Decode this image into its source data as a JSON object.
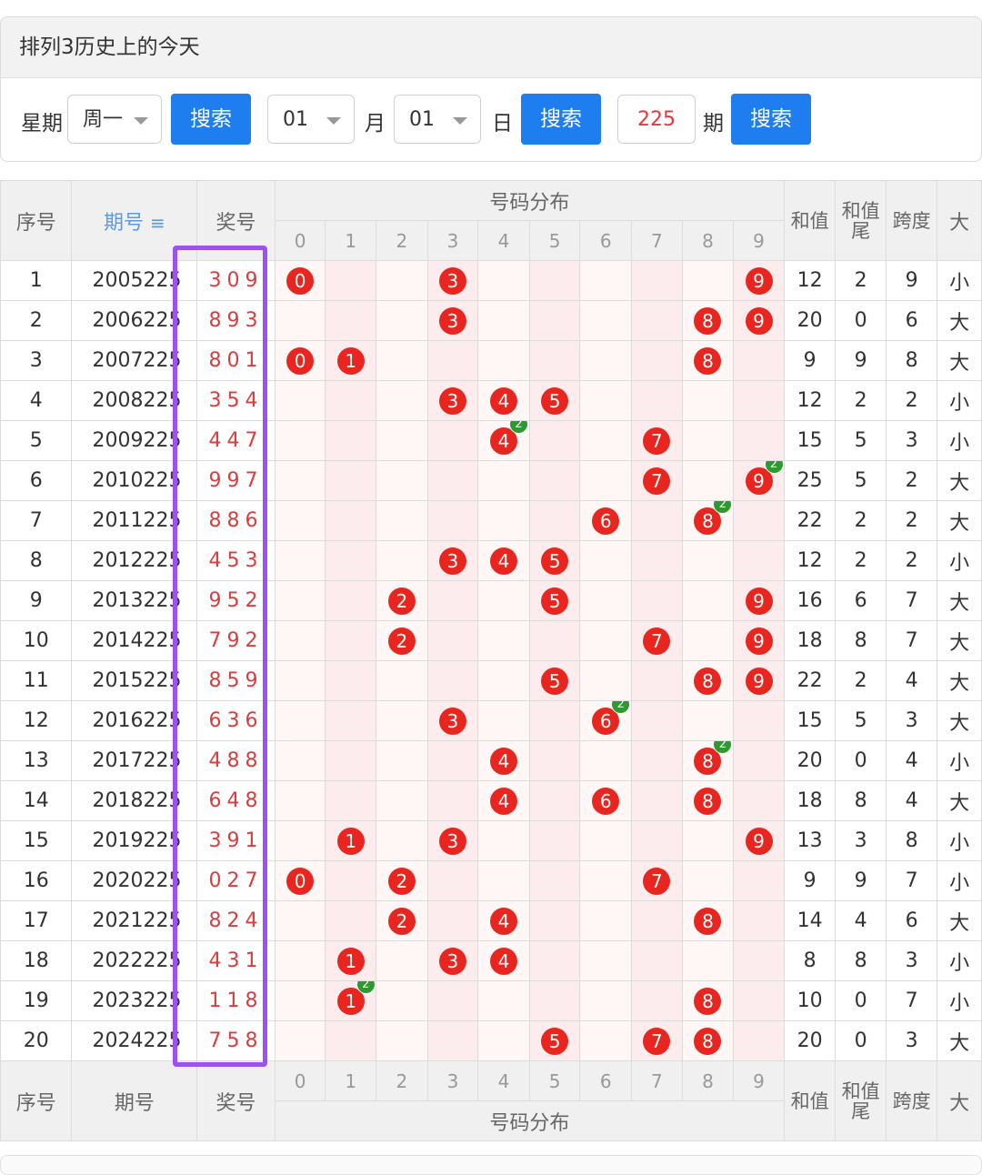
{
  "panel": {
    "title": "排列3历史上的今天",
    "weekday_label": "星期",
    "weekday_value": "周一",
    "search_label": "搜索",
    "month_value": "01",
    "month_label": "月",
    "day_value": "01",
    "day_label": "日",
    "period_value": "225",
    "period_label": "期"
  },
  "table": {
    "headers": {
      "seq": "序号",
      "period": "期号",
      "period_sort_icon": "sort-icon",
      "number": "奖号",
      "distribution": "号码分布",
      "digits": [
        "0",
        "1",
        "2",
        "3",
        "4",
        "5",
        "6",
        "7",
        "8",
        "9"
      ],
      "sum": "和值",
      "sum_tail": "和值尾",
      "span": "跨度",
      "size": "大"
    },
    "rows": [
      {
        "seq": "1",
        "period": "2005225",
        "num": "309",
        "digits": [
          0,
          3,
          9
        ],
        "rep": {},
        "sum": "12",
        "tail": "2",
        "span": "9",
        "size": "小"
      },
      {
        "seq": "2",
        "period": "2006225",
        "num": "893",
        "digits": [
          3,
          8,
          9
        ],
        "rep": {},
        "sum": "20",
        "tail": "0",
        "span": "6",
        "size": "大"
      },
      {
        "seq": "3",
        "period": "2007225",
        "num": "801",
        "digits": [
          0,
          1,
          8
        ],
        "rep": {},
        "sum": "9",
        "tail": "9",
        "span": "8",
        "size": "大"
      },
      {
        "seq": "4",
        "period": "2008225",
        "num": "354",
        "digits": [
          3,
          4,
          5
        ],
        "rep": {},
        "sum": "12",
        "tail": "2",
        "span": "2",
        "size": "小"
      },
      {
        "seq": "5",
        "period": "2009225",
        "num": "447",
        "digits": [
          4,
          7
        ],
        "rep": {
          "4": "2"
        },
        "sum": "15",
        "tail": "5",
        "span": "3",
        "size": "小"
      },
      {
        "seq": "6",
        "period": "2010225",
        "num": "997",
        "digits": [
          7,
          9
        ],
        "rep": {
          "9": "2"
        },
        "sum": "25",
        "tail": "5",
        "span": "2",
        "size": "大"
      },
      {
        "seq": "7",
        "period": "2011225",
        "num": "886",
        "digits": [
          6,
          8
        ],
        "rep": {
          "8": "2"
        },
        "sum": "22",
        "tail": "2",
        "span": "2",
        "size": "大"
      },
      {
        "seq": "8",
        "period": "2012225",
        "num": "453",
        "digits": [
          3,
          4,
          5
        ],
        "rep": {},
        "sum": "12",
        "tail": "2",
        "span": "2",
        "size": "小"
      },
      {
        "seq": "9",
        "period": "2013225",
        "num": "952",
        "digits": [
          2,
          5,
          9
        ],
        "rep": {},
        "sum": "16",
        "tail": "6",
        "span": "7",
        "size": "大"
      },
      {
        "seq": "10",
        "period": "2014225",
        "num": "792",
        "digits": [
          2,
          7,
          9
        ],
        "rep": {},
        "sum": "18",
        "tail": "8",
        "span": "7",
        "size": "大"
      },
      {
        "seq": "11",
        "period": "2015225",
        "num": "859",
        "digits": [
          5,
          8,
          9
        ],
        "rep": {},
        "sum": "22",
        "tail": "2",
        "span": "4",
        "size": "大"
      },
      {
        "seq": "12",
        "period": "2016225",
        "num": "636",
        "digits": [
          3,
          6
        ],
        "rep": {
          "6": "2"
        },
        "sum": "15",
        "tail": "5",
        "span": "3",
        "size": "大"
      },
      {
        "seq": "13",
        "period": "2017225",
        "num": "488",
        "digits": [
          4,
          8
        ],
        "rep": {
          "8": "2"
        },
        "sum": "20",
        "tail": "0",
        "span": "4",
        "size": "小"
      },
      {
        "seq": "14",
        "period": "2018225",
        "num": "648",
        "digits": [
          4,
          6,
          8
        ],
        "rep": {},
        "sum": "18",
        "tail": "8",
        "span": "4",
        "size": "大"
      },
      {
        "seq": "15",
        "period": "2019225",
        "num": "391",
        "digits": [
          1,
          3,
          9
        ],
        "rep": {},
        "sum": "13",
        "tail": "3",
        "span": "8",
        "size": "小"
      },
      {
        "seq": "16",
        "period": "2020225",
        "num": "027",
        "digits": [
          0,
          2,
          7
        ],
        "rep": {},
        "sum": "9",
        "tail": "9",
        "span": "7",
        "size": "小"
      },
      {
        "seq": "17",
        "period": "2021225",
        "num": "824",
        "digits": [
          2,
          4,
          8
        ],
        "rep": {},
        "sum": "14",
        "tail": "4",
        "span": "6",
        "size": "大"
      },
      {
        "seq": "18",
        "period": "2022225",
        "num": "431",
        "digits": [
          1,
          3,
          4
        ],
        "rep": {},
        "sum": "8",
        "tail": "8",
        "span": "3",
        "size": "小"
      },
      {
        "seq": "19",
        "period": "2023225",
        "num": "118",
        "digits": [
          1,
          8
        ],
        "rep": {
          "1": "2"
        },
        "sum": "10",
        "tail": "0",
        "span": "7",
        "size": "小"
      },
      {
        "seq": "20",
        "period": "2024225",
        "num": "758",
        "digits": [
          5,
          7,
          8
        ],
        "rep": {},
        "sum": "20",
        "tail": "0",
        "span": "3",
        "size": "大"
      }
    ]
  },
  "colors": {
    "accent_blue": "#1e7ef0",
    "ball_red": "#e8261f",
    "repeat_green": "#2e9a2e",
    "highlight_purple": "#9a52f0"
  }
}
